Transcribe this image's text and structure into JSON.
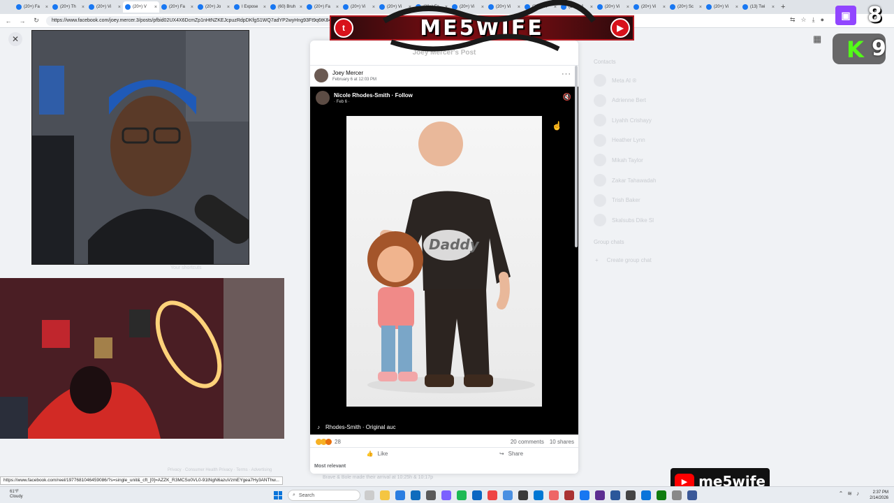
{
  "browser": {
    "tabs": [
      {
        "label": "(20+) Fa"
      },
      {
        "label": "(20+) Th"
      },
      {
        "label": "(20+) Vi"
      },
      {
        "label": "(20+) V"
      },
      {
        "label": "(20+) Fa"
      },
      {
        "label": "(20+) Jo"
      },
      {
        "label": "I Expose"
      },
      {
        "label": "(60) Bruh"
      },
      {
        "label": "(20+) Fa"
      },
      {
        "label": "(20+) Vi"
      },
      {
        "label": "(20+) Vi"
      },
      {
        "label": "(20+) Fa"
      },
      {
        "label": "(20+) Vi"
      },
      {
        "label": "(20+) Vi"
      },
      {
        "label": "(20+) Vi"
      },
      {
        "label": "(20+) Vi"
      },
      {
        "label": "(20+) Vi"
      },
      {
        "label": "(20+) Vi"
      },
      {
        "label": "(20+) Sc"
      },
      {
        "label": "(20+) Vi"
      },
      {
        "label": "(13) Twi"
      }
    ],
    "url": "https://www.facebook.com/joey.mercer.3/posts/pfbid02UX4X6DcmZp1nHtNZKEJcpuzRdpDKfgS1WQ7adYP2wyHng93Ft9q6tK84m",
    "status_url": "https://www.facebook.com/reel/1977681046459086/?s=single_unit&_cft_[0]=AZZK_R3MCSo0VL0-91tNgN6azuVzmEYgea7Hy3ANThw..."
  },
  "facebook": {
    "modal_title": "Joey Mercer's Post",
    "author": "Joey Mercer",
    "post_date": "February 6 at 12:03 PM",
    "reel_author": "Nicole Rhodes-Smith · Follow",
    "reel_date": "· Feb 6 ·",
    "artwork_label": "Daddy",
    "audio": "Rhodes-Smith · Original auc",
    "reaction_count": "28",
    "comments": "20 comments",
    "shares": "10 shares",
    "like_label": "Like",
    "share_label": "Share",
    "most_relevant": "Most relevant",
    "contacts_title": "Contacts",
    "contacts": [
      "Meta AI ®",
      "Adrienne Bert",
      "Liyahh Crishayy",
      "Heather Lynn",
      "Mikah Taylor",
      "Zakar Tahawadah",
      "Trish Baker",
      "Skalsubs Dike Sl"
    ],
    "group_chats_title": "Group chats",
    "create_group": "Create group chat",
    "faded_caption": "Brave & Bole made their arrival at 10:25h & 10:17p",
    "faded_footer": "Privacy · Consumer Health Privacy · Terms · Advertising"
  },
  "overlays": {
    "banner_text": "ME5WIFE",
    "twitch_count": "8",
    "kick_count": "9",
    "kick_letter": "K",
    "youtube_handle": "me5wife",
    "cam_caption": "Your shortcuts"
  },
  "taskbar": {
    "weather_temp": "61°F",
    "weather_desc": "Cloudy",
    "search_placeholder": "Search",
    "time": "2:37 PM",
    "date": "2/14/2026"
  },
  "colors": {
    "facebook_blue": "#1877f2",
    "twitch_purple": "#9146ff",
    "kick_green": "#53fc18",
    "youtube_red": "#ff0000",
    "banner_red": "#b61a22"
  }
}
